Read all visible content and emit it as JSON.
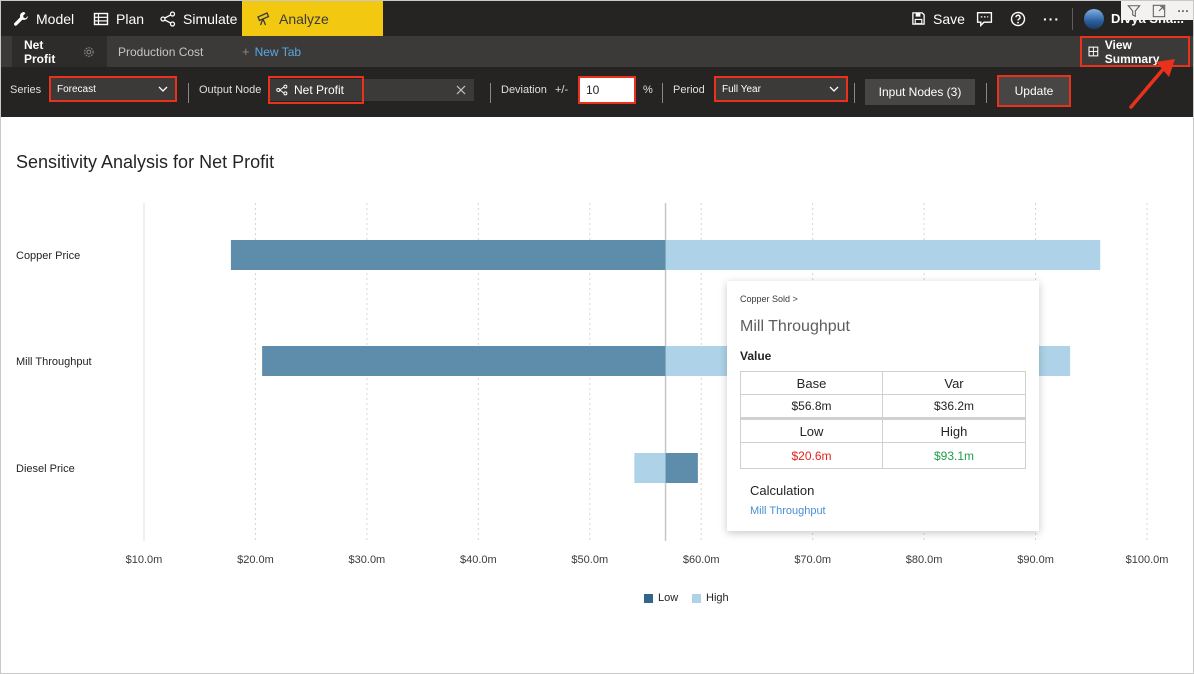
{
  "menu": {
    "items": [
      {
        "label": "Model",
        "icon": "wrench-icon"
      },
      {
        "label": "Plan",
        "icon": "table-icon"
      },
      {
        "label": "Simulate",
        "icon": "share-nodes-icon"
      },
      {
        "label": "Analyze",
        "icon": "telescope-icon",
        "active": true
      }
    ],
    "save_label": "Save",
    "user_name": "Divya Sha..."
  },
  "tabs": {
    "items": [
      {
        "label": "Net Profit",
        "active": true
      },
      {
        "label": "Production Cost",
        "active": false
      }
    ],
    "new_tab_label": "New Tab",
    "view_summary_label": "View Summary"
  },
  "toolbar": {
    "series_label": "Series",
    "series_value": "Forecast",
    "output_node_label": "Output Node",
    "output_node_value": "Net Profit",
    "deviation_label": "Deviation",
    "plusminus": "+/-",
    "deviation_value": "10",
    "percent": "%",
    "period_label": "Period",
    "period_value": "Full Year",
    "input_nodes_label": "Input Nodes (3)",
    "update_label": "Update"
  },
  "chart_data": {
    "type": "bar",
    "orientation": "horizontal-tornado",
    "title": "Sensitivity Analysis for Net Profit",
    "categories": [
      "Copper Price",
      "Mill Throughput",
      "Diesel Price"
    ],
    "base": 56.8,
    "series": [
      {
        "name": "Low",
        "values": [
          17.8,
          20.6,
          59.7
        ],
        "color": "#5e8cab"
      },
      {
        "name": "High",
        "values": [
          95.8,
          93.1,
          54.0
        ],
        "color": "#aed3e8"
      }
    ],
    "xlim": [
      10,
      100
    ],
    "xticks": [
      "$10.0m",
      "$20.0m",
      "$30.0m",
      "$40.0m",
      "$50.0m",
      "$60.0m",
      "$70.0m",
      "$80.0m",
      "$90.0m",
      "$100.0m"
    ],
    "grid": true,
    "legend": "bottom"
  },
  "tooltip": {
    "crumb": "Copper Sold >",
    "title": "Mill Throughput",
    "section": "Value",
    "base_label": "Base",
    "var_label": "Var",
    "base_value": "$56.8m",
    "var_value": "$36.2m",
    "low_label": "Low",
    "high_label": "High",
    "low_value": "$20.6m",
    "high_value": "$93.1m",
    "low_color": "#e8201c",
    "high_color": "#1f9e4a",
    "calc_label": "Calculation",
    "calc_link": "Mill Throughput"
  },
  "colors": {
    "accent": "#f2c811",
    "highlight": "#e8321c",
    "link": "#5aa7e3"
  }
}
